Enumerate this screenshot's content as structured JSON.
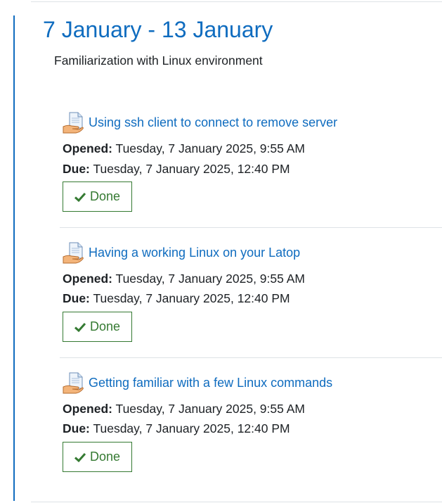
{
  "section": {
    "title": "7 January - 13 January",
    "summary": "Familiarization with Linux environment"
  },
  "activities": [
    {
      "icon": "assignment-icon",
      "title": "Using ssh client to connect to remove server",
      "opened_label": "Opened:",
      "opened_value": "Tuesday, 7 January 2025, 9:55 AM",
      "due_label": "Due:",
      "due_value": "Tuesday, 7 January 2025, 12:40 PM",
      "status_label": "Done"
    },
    {
      "icon": "assignment-icon",
      "title": "Having a working Linux on your Latop",
      "opened_label": "Opened:",
      "opened_value": "Tuesday, 7 January 2025, 9:55 AM",
      "due_label": "Due:",
      "due_value": "Tuesday, 7 January 2025, 12:40 PM",
      "status_label": "Done"
    },
    {
      "icon": "assignment-icon",
      "title": "Getting familiar with a few Linux commands",
      "opened_label": "Opened:",
      "opened_value": "Tuesday, 7 January 2025, 9:55 AM",
      "due_label": "Due:",
      "due_value": "Tuesday, 7 January 2025, 12:40 PM",
      "status_label": "Done"
    }
  ],
  "colors": {
    "link": "#0f6cbf",
    "done": "#357a32",
    "text": "#1d2125",
    "divider": "#dee2e6"
  }
}
